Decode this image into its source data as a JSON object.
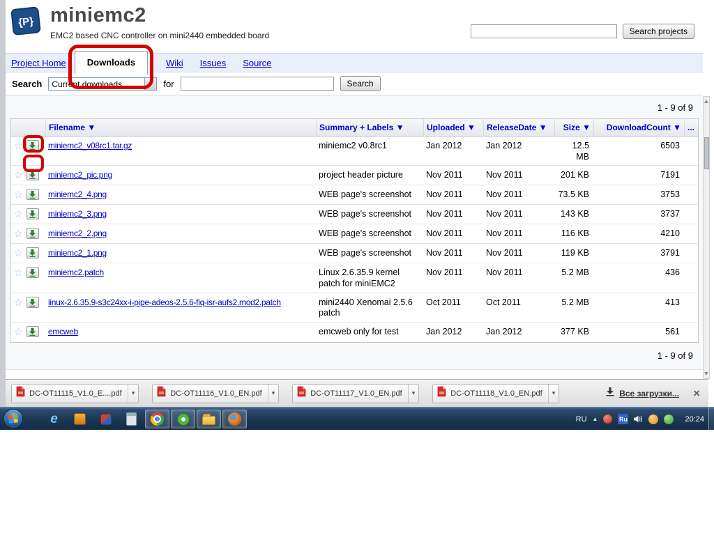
{
  "project": {
    "name": "miniemc2",
    "tagline": "EMC2 based CNC controller on mini2440 embedded board"
  },
  "top_search": {
    "value": "",
    "button_label": "Search projects"
  },
  "nav": {
    "project_home": "Project Home",
    "downloads": "Downloads",
    "wiki": "Wiki",
    "issues": "Issues",
    "source": "Source"
  },
  "filter_bar": {
    "search_label": "Search",
    "scope_value": "Current downloads",
    "for_label": "for",
    "query_value": "",
    "search_button": "Search"
  },
  "listing": {
    "pagination": "1 - 9 of 9",
    "headers": [
      "Filename ▼",
      "Summary + Labels ▼",
      "Uploaded ▼",
      "ReleaseDate ▼",
      "Size ▼",
      "DownloadCount ▼",
      "..."
    ],
    "rows": [
      {
        "filename": "miniemc2_v08rc1.tar.gz",
        "summary": "miniemc2 v0.8rc1",
        "uploaded": "Jan 2012",
        "release_date": "Jan 2012",
        "size": "12.5 MB",
        "count": "6503"
      },
      {
        "filename": "miniemc2_pic.png",
        "summary": "project header picture",
        "uploaded": "Nov 2011",
        "release_date": "Nov 2011",
        "size": "201 KB",
        "count": "7191"
      },
      {
        "filename": "miniemc2_4.png",
        "summary": "WEB page's screenshot",
        "uploaded": "Nov 2011",
        "release_date": "Nov 2011",
        "size": "73.5 KB",
        "count": "3753"
      },
      {
        "filename": "miniemc2_3.png",
        "summary": "WEB page's screenshot",
        "uploaded": "Nov 2011",
        "release_date": "Nov 2011",
        "size": "143 KB",
        "count": "3737"
      },
      {
        "filename": "miniemc2_2.png",
        "summary": "WEB page's screenshot",
        "uploaded": "Nov 2011",
        "release_date": "Nov 2011",
        "size": "116 KB",
        "count": "4210"
      },
      {
        "filename": "miniemc2_1.png",
        "summary": "WEB page's screenshot",
        "uploaded": "Nov 2011",
        "release_date": "Nov 2011",
        "size": "119 KB",
        "count": "3791"
      },
      {
        "filename": "miniemc2.patch",
        "summary": "Linux 2.6.35.9 kernel patch for miniEMC2",
        "uploaded": "Nov 2011",
        "release_date": "Nov 2011",
        "size": "5.2 MB",
        "count": "436"
      },
      {
        "filename": "linux-2.6.35.9-s3c24xx-i-pipe-adeos-2.5.6-fiq-isr-aufs2.mod2.patch",
        "summary": "mini2440 Xenomai 2.5.6 patch",
        "uploaded": "Oct 2011",
        "release_date": "Oct 2011",
        "size": "5.2 MB",
        "count": "413"
      },
      {
        "filename": "emcweb",
        "summary": "emcweb only for test",
        "uploaded": "Jan 2012",
        "release_date": "Jan 2012",
        "size": "377 KB",
        "count": "561"
      }
    ]
  },
  "downloads_bar": {
    "items": [
      "DC-OT11115_V1.0_E....pdf",
      "DC-OT11116_V1.0_EN.pdf",
      "DC-OT11117_V1.0_EN.pdf",
      "DC-OT11118_V1.0_EN.pdf"
    ],
    "all_downloads_label": "Все загрузки..."
  },
  "taskbar": {
    "language": "RU",
    "tray_language_badge": "Ru",
    "time": "20:24"
  },
  "icons": {
    "logo_glyph": "{P}",
    "star": "☆",
    "select_arrow": "▼",
    "caret": "▾",
    "close": "×",
    "tray_expand": "▲",
    "ie_glyph": "e"
  },
  "colors": {
    "link": "#0000cc",
    "annotation_red": "#d60000",
    "nav_background": "#e9f0fb"
  }
}
